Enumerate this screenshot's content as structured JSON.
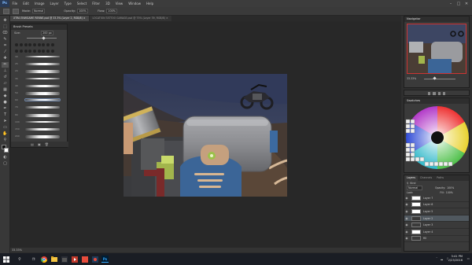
{
  "app": {
    "logo": "Ps",
    "menu": [
      "File",
      "Edit",
      "Image",
      "Layer",
      "Type",
      "Select",
      "Filter",
      "3D",
      "View",
      "Window",
      "Help"
    ],
    "window_controls": [
      "–",
      "□",
      "✕"
    ]
  },
  "options_bar": {
    "mode_label": "Mode:",
    "mode_value": "Normal",
    "opacity_label": "Opacity:",
    "opacity_value": "100%",
    "flow_label": "Flow:",
    "flow_value": "100%"
  },
  "tabs": [
    {
      "label": "XTRA ENWGAME RENNE.psd @ 33.3% (Layer 2, RGB/8) ×",
      "active": true
    },
    {
      "label": "LOCATION TATTOO GARAGE.psd @ 75% (Layer 39, RGB/8) ×",
      "active": false
    }
  ],
  "brush_presets": {
    "title": "Brush Presets",
    "size_label": "Size:",
    "size_value": "200 px",
    "stroke_numbers": [
      "30",
      "25",
      "20",
      "35",
      "40",
      "50",
      "60",
      "70",
      "80",
      "100",
      "150",
      "200"
    ]
  },
  "status_bar": {
    "zoom": "33.33%"
  },
  "panels": {
    "navigator": {
      "title": "Navigator",
      "zoom": "33.33%"
    },
    "swatches": {
      "title": "Swatches"
    },
    "layers": {
      "title": "Layers",
      "tabs": [
        "Layers",
        "Channels",
        "Paths"
      ],
      "kind_label": "Kind",
      "blend_mode": "Normal",
      "opacity_label": "Opacity:",
      "opacity_value": "100%",
      "lock_label": "Lock:",
      "fill_label": "Fill:",
      "fill_value": "100%",
      "rows": [
        {
          "name": "Layer 7",
          "visible": true,
          "selected": false,
          "dark": false
        },
        {
          "name": "Layer 6",
          "visible": true,
          "selected": false,
          "dark": false
        },
        {
          "name": "Layer 5",
          "visible": true,
          "selected": false,
          "dark": false
        },
        {
          "name": "Layer 2",
          "visible": true,
          "selected": true,
          "dark": true
        },
        {
          "name": "Layer 3",
          "visible": true,
          "selected": false,
          "dark": true
        },
        {
          "name": "Layer 4",
          "visible": true,
          "selected": false,
          "dark": false
        },
        {
          "name": "fill",
          "visible": true,
          "selected": false,
          "dark": true
        }
      ]
    }
  },
  "taskbar": {
    "clock_time": "3:41 PM",
    "clock_date": "2/23/2016"
  },
  "colors": {
    "accent": "#2f7ad6",
    "photoshop_blue": "#31a8ff",
    "canvas_sky": "#3d4663",
    "canvas_ground": "#6b5a4a"
  }
}
